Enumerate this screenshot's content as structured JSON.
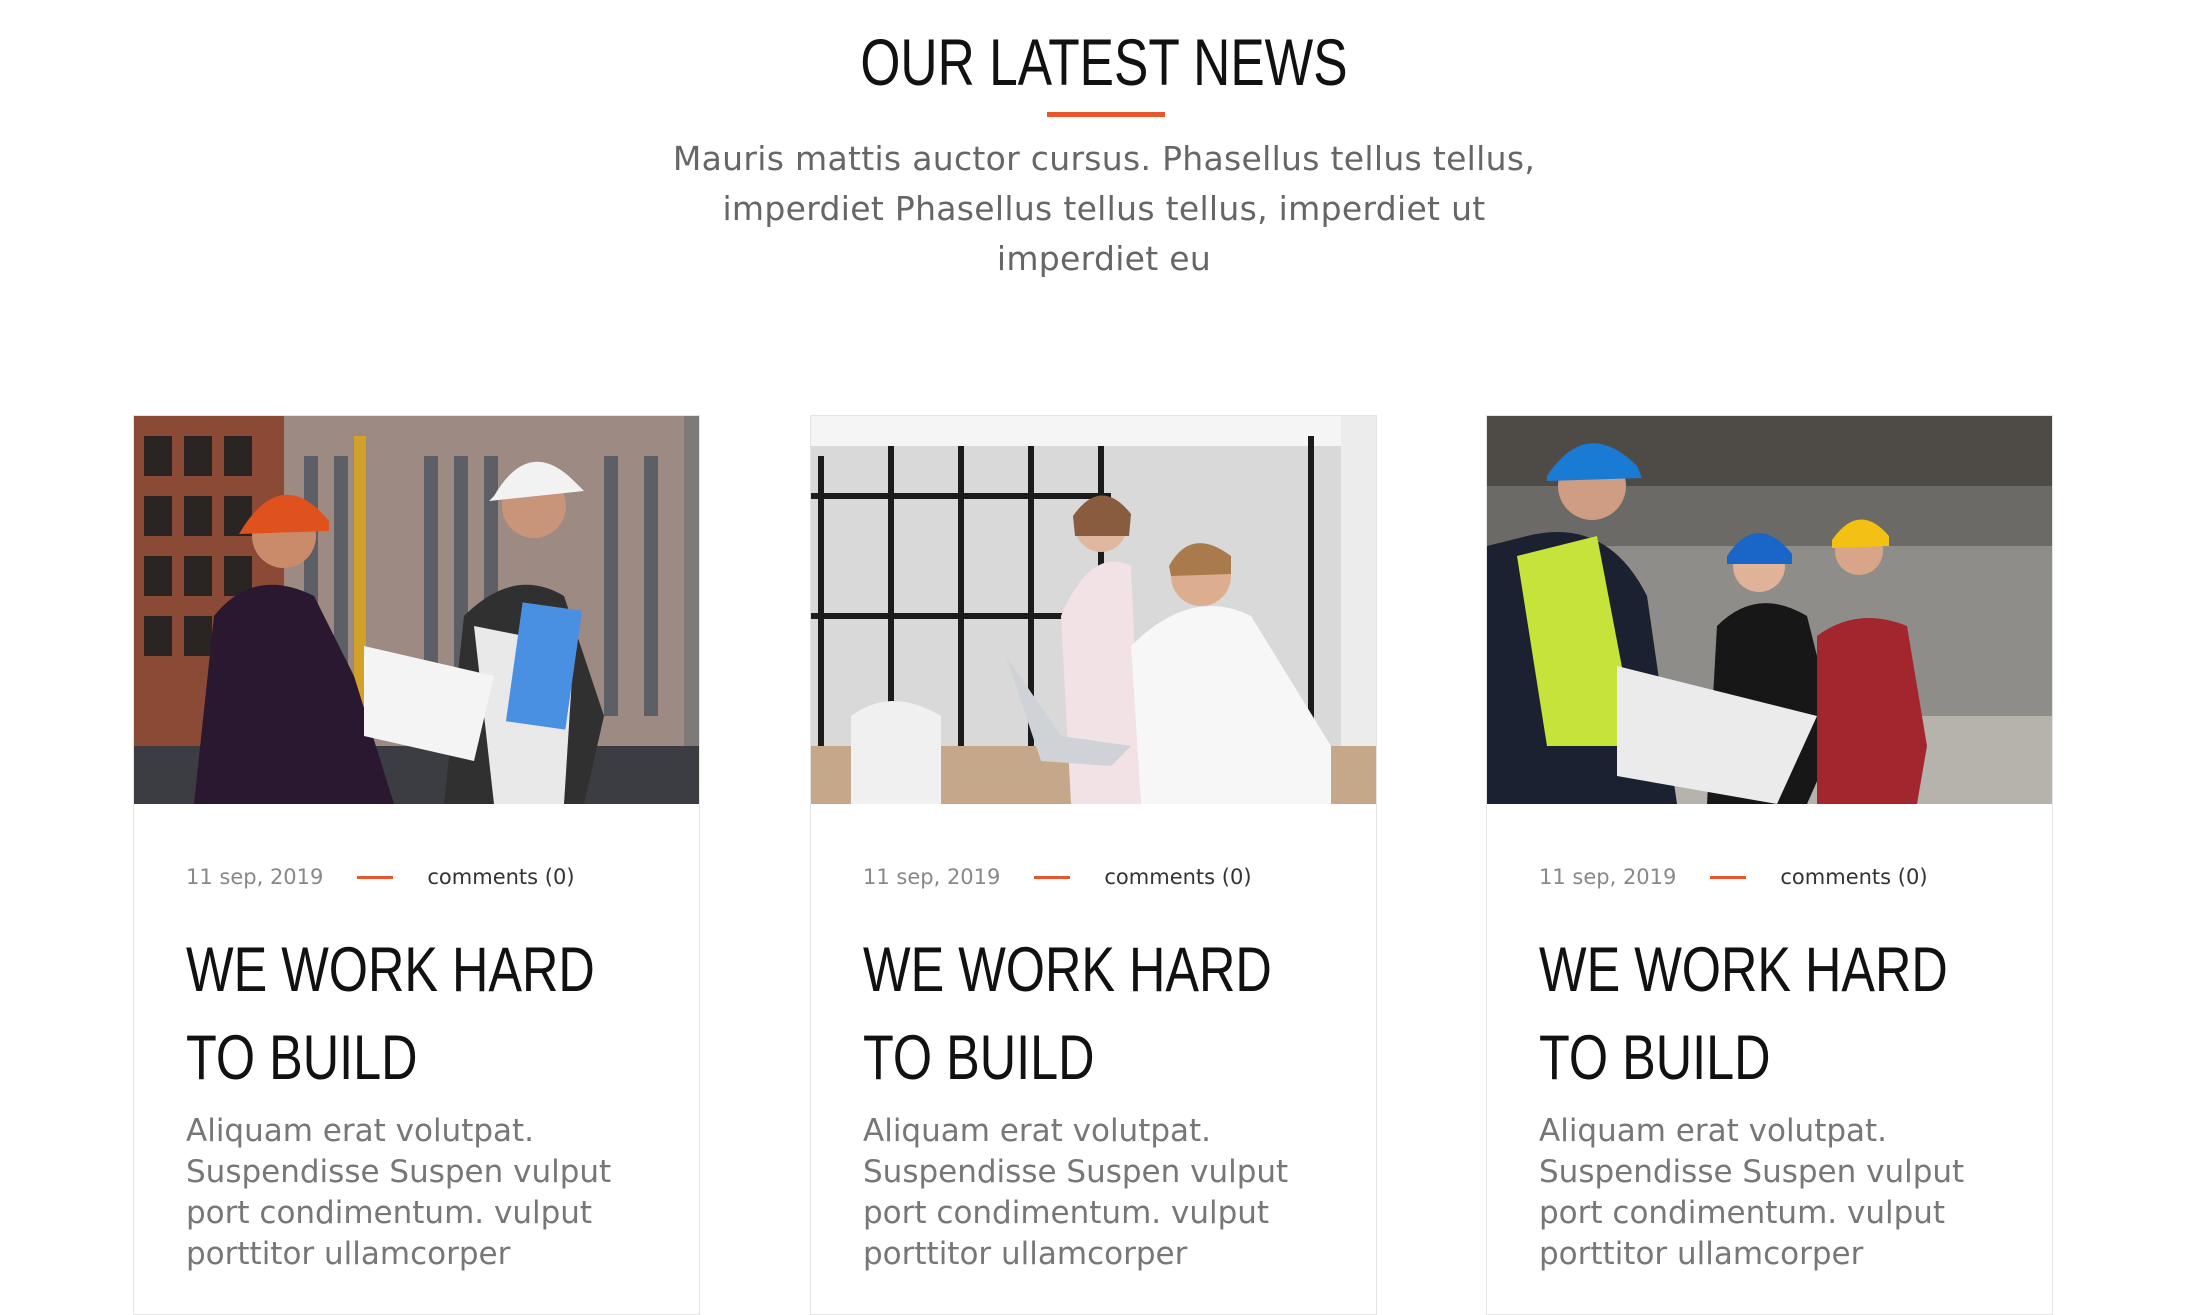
{
  "section": {
    "title": "OUR LATEST NEWS",
    "subtitle": "Mauris mattis auctor cursus. Phasellus tellus tellus, imperdiet Phasellus tellus tellus, imperdiet ut imperdiet eu",
    "accent_color": "#e8562a"
  },
  "cards": [
    {
      "image": "construction-workers-outdoor-photo",
      "date": "11 sep, 2019",
      "comments": "comments (0)",
      "title": "WE WORK HARD TO BUILD",
      "excerpt": "Aliquam erat volutpat. Suspendisse Suspen vulput port condimentum. vulput porttitor ullamcorper"
    },
    {
      "image": "office-people-laptop-photo",
      "date": "11 sep, 2019",
      "comments": "comments (0)",
      "title": "WE WORK HARD TO BUILD",
      "excerpt": "Aliquam erat volutpat. Suspendisse Suspen vulput port condimentum. vulput porttitor ullamcorper"
    },
    {
      "image": "engineers-warehouse-plans-photo",
      "date": "11 sep, 2019",
      "comments": "comments (0)",
      "title": "WE WORK HARD TO BUILD",
      "excerpt": "Aliquam erat volutpat. Suspendisse Suspen vulput port condimentum. vulput porttitor ullamcorper"
    }
  ]
}
